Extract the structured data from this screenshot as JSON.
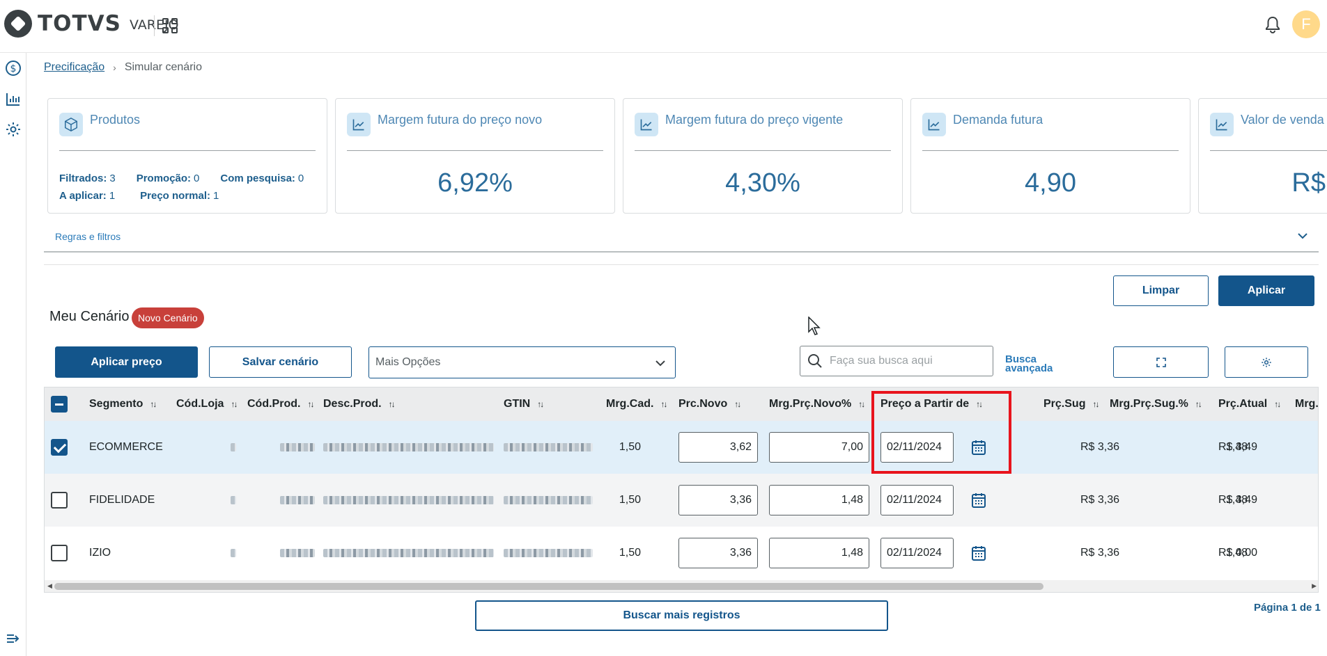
{
  "header": {
    "brand": "TOTVS",
    "product": "VAREJO",
    "avatar_initial": "F"
  },
  "breadcrumb": {
    "parent": "Precificação",
    "current": "Simular cenário"
  },
  "cards": [
    {
      "title": "Produtos",
      "icon": "cube-icon",
      "stats": {
        "filtrados_label": "Filtrados:",
        "filtrados": "3",
        "promocao_label": "Promoção:",
        "promocao": "0",
        "pesquisa_label": "Com pesquisa:",
        "pesquisa": "0",
        "aplicar_label": "A aplicar:",
        "aplicar": "1",
        "normal_label": "Preço normal:",
        "normal": "1"
      }
    },
    {
      "title": "Margem futura do preço novo",
      "icon": "trend-icon",
      "value": "6,92%"
    },
    {
      "title": "Margem futura do preço vigente",
      "icon": "trend-icon",
      "value": "4,30%"
    },
    {
      "title": "Demanda futura",
      "icon": "trend-icon",
      "value": "4,90"
    },
    {
      "title": "Valor de venda",
      "icon": "trend-icon",
      "value": "R$"
    }
  ],
  "rules_label": "Regras e filtros",
  "actions": {
    "clear": "Limpar",
    "apply": "Aplicar"
  },
  "scenario": {
    "title": "Meu Cenário",
    "badge": "Novo Cenário"
  },
  "toolbar": {
    "apply_price": "Aplicar preço",
    "save_scenario": "Salvar cenário",
    "more_options": "Mais Opções",
    "search_placeholder": "Faça sua busca aqui",
    "advanced_search_1": "Busca",
    "advanced_search_2": "avançada"
  },
  "table": {
    "columns": [
      "Segmento",
      "Cód.Loja",
      "Cód.Prod.",
      "Desc.Prod.",
      "GTIN",
      "Mrg.Cad.",
      "Prc.Novo",
      "Mrg.Prç.Novo%",
      "Preço a Partir de",
      "Prç.Sug",
      "Mrg.Prç.Sug.%",
      "Prç.Atual",
      "Mrg.Pr"
    ],
    "rows": [
      {
        "segmento": "ECOMMERCE",
        "mrg_cad": "1,50",
        "prc_novo": "3,62",
        "mrg_novo": "7,00",
        "data": "02/11/2024",
        "prc_sug": "R$ 3,36",
        "mrg_sug": "1,48",
        "prc_atual": "R$ 3,49",
        "checked": true
      },
      {
        "segmento": "FIDELIDADE",
        "mrg_cad": "1,50",
        "prc_novo": "3,36",
        "mrg_novo": "1,48",
        "data": "02/11/2024",
        "prc_sug": "R$ 3,36",
        "mrg_sug": "1,48",
        "prc_atual": "R$ 3,49",
        "checked": false
      },
      {
        "segmento": "IZIO",
        "mrg_cad": "1,50",
        "prc_novo": "3,36",
        "mrg_novo": "1,48",
        "data": "02/11/2024",
        "prc_sug": "R$ 3,36",
        "mrg_sug": "1,48",
        "prc_atual": "R$ 0,00",
        "checked": false
      }
    ]
  },
  "footer": {
    "load_more": "Buscar mais registros",
    "page_info": "Página 1 de 1"
  },
  "colors": {
    "primary": "#13558b",
    "badge": "#c8403a",
    "highlight": "#e8141d",
    "value": "#2b6c9b"
  }
}
